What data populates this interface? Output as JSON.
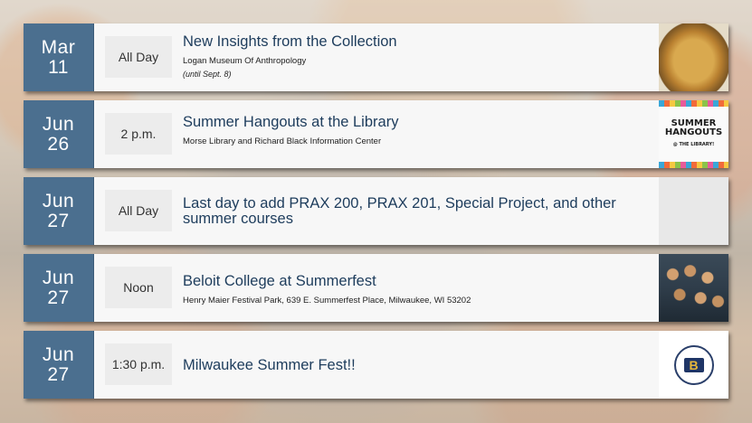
{
  "events": [
    {
      "month": "Mar",
      "day": "11",
      "time": "All Day",
      "title": "New Insights from the Collection",
      "location": "Logan Museum Of Anthropology",
      "note": "(until Sept. 8)",
      "image": "jar-artifact"
    },
    {
      "month": "Jun",
      "day": "26",
      "time": "2 p.m.",
      "title": "Summer Hangouts at the Library",
      "location": "Morse Library and Richard Black Information Center",
      "note": "",
      "image": "summer-hangouts-poster"
    },
    {
      "month": "Jun",
      "day": "27",
      "time": "All Day",
      "title": "Last day to add PRAX 200, PRAX 201, Special Project, and other summer courses",
      "location": "",
      "note": "",
      "image": "blank"
    },
    {
      "month": "Jun",
      "day": "27",
      "time": "Noon",
      "title": "Beloit College at Summerfest",
      "location": "Henry Maier Festival Park, 639 E. Summerfest Place, Milwaukee, WI 53202",
      "note": "",
      "image": "crowd-photo"
    },
    {
      "month": "Jun",
      "day": "27",
      "time": "1:30 p.m.",
      "title": "Milwaukee Summer Fest!!",
      "location": "",
      "note": "",
      "image": "beloit-college-seal"
    }
  ],
  "poster": {
    "line1": "SUMMER",
    "line2": "HANGOUTS",
    "line3": "@ THE LIBRARY!"
  },
  "logo": {
    "letter": "B"
  },
  "colors": {
    "date_block": "#4b6f8f",
    "title_text": "#1d3c5c",
    "card_bg": "#f7f7f7",
    "time_bg": "#ececec"
  }
}
